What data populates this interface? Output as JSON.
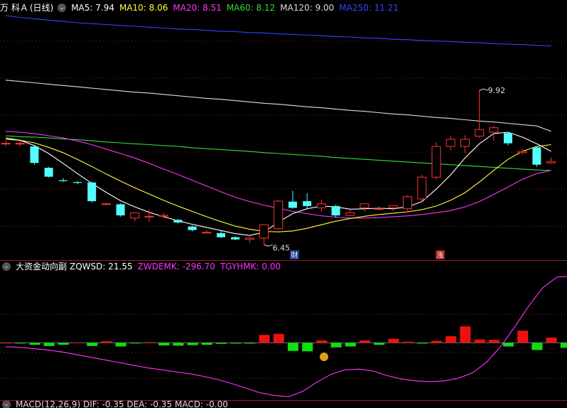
{
  "main_panel": {
    "stock_name": "万 科Ａ",
    "period": "(日线)",
    "ma_items": [
      {
        "label": "MA5: 7.94",
        "color": "#ffffff"
      },
      {
        "label": "MA10: 8.06",
        "color": "#ffff33"
      },
      {
        "label": "MA20: 8.51",
        "color": "#ff33ff"
      },
      {
        "label": "MA60: 8.12",
        "color": "#33dd33"
      },
      {
        "label": "MA120: 9.00",
        "color": "#dddddd"
      },
      {
        "label": "MA250: 11.21",
        "color": "#3344ff"
      }
    ],
    "high_marker": "9.92",
    "low_marker": "6.45",
    "badge_cai": "财",
    "badge_zhang": "涨"
  },
  "sub_panel": {
    "indicator_name": "大资金动向副",
    "items": [
      {
        "label": "ZQWSD: 21.55",
        "color": "#ffffff"
      },
      {
        "label": "ZWDEMK: -296.70",
        "color": "#ff33ff"
      },
      {
        "label": "TGYHMK: 0.00",
        "color": "#ff33ff"
      }
    ]
  },
  "bottom_panel": {
    "partial_legend": "MACD(12,26,9)  DIF: -0.35  DEA: -0.35  MACD: -0.00"
  },
  "colors": {
    "up": "#ff3333",
    "down": "#54ffff",
    "grid": "#9b1c1c",
    "ma5": "#ffffff",
    "ma10": "#ffff33",
    "ma20": "#ff33ff",
    "ma60": "#33dd33",
    "ma120": "#dddddd",
    "ma250": "#3344ff"
  },
  "chart_data": {
    "type": "candlestick",
    "price_range": [
      6.2,
      11.6
    ],
    "candles": [
      {
        "o": 8.73,
        "h": 8.79,
        "l": 8.66,
        "c": 8.73
      },
      {
        "o": 8.73,
        "h": 8.79,
        "l": 8.66,
        "c": 8.73
      },
      {
        "o": 8.66,
        "h": 8.68,
        "l": 8.25,
        "c": 8.29
      },
      {
        "o": 8.18,
        "h": 8.2,
        "l": 7.96,
        "c": 7.98
      },
      {
        "o": 7.9,
        "h": 7.95,
        "l": 7.86,
        "c": 7.88
      },
      {
        "o": 7.86,
        "h": 7.88,
        "l": 7.81,
        "c": 7.84
      },
      {
        "o": 7.85,
        "h": 7.87,
        "l": 7.4,
        "c": 7.43
      },
      {
        "o": 7.36,
        "h": 7.4,
        "l": 7.34,
        "c": 7.37
      },
      {
        "o": 7.36,
        "h": 7.38,
        "l": 7.08,
        "c": 7.11
      },
      {
        "o": 7.05,
        "h": 7.17,
        "l": 6.98,
        "c": 7.17
      },
      {
        "o": 7.09,
        "h": 7.24,
        "l": 6.96,
        "c": 7.09
      },
      {
        "o": 7.09,
        "h": 7.17,
        "l": 7.05,
        "c": 7.11
      },
      {
        "o": 7.01,
        "h": 7.03,
        "l": 6.93,
        "c": 6.95
      },
      {
        "o": 6.86,
        "h": 6.88,
        "l": 6.75,
        "c": 6.78
      },
      {
        "o": 6.73,
        "h": 6.78,
        "l": 6.71,
        "c": 6.73
      },
      {
        "o": 6.71,
        "h": 6.76,
        "l": 6.6,
        "c": 6.62
      },
      {
        "o": 6.62,
        "h": 6.64,
        "l": 6.55,
        "c": 6.57
      },
      {
        "o": 6.57,
        "h": 6.64,
        "l": 6.5,
        "c": 6.6
      },
      {
        "o": 6.6,
        "h": 6.9,
        "l": 6.45,
        "c": 6.9
      },
      {
        "o": 6.81,
        "h": 7.46,
        "l": 6.79,
        "c": 7.43
      },
      {
        "o": 7.42,
        "h": 7.66,
        "l": 7.26,
        "c": 7.28
      },
      {
        "o": 7.43,
        "h": 7.61,
        "l": 7.26,
        "c": 7.32
      },
      {
        "o": 7.28,
        "h": 7.46,
        "l": 7.19,
        "c": 7.37
      },
      {
        "o": 7.32,
        "h": 7.35,
        "l": 7.06,
        "c": 7.11
      },
      {
        "o": 7.11,
        "h": 7.24,
        "l": 7.11,
        "c": 7.17
      },
      {
        "o": 7.28,
        "h": 7.37,
        "l": 7.19,
        "c": 7.37
      },
      {
        "o": 7.26,
        "h": 7.32,
        "l": 7.24,
        "c": 7.26
      },
      {
        "o": 7.28,
        "h": 7.33,
        "l": 7.21,
        "c": 7.33
      },
      {
        "o": 7.26,
        "h": 7.57,
        "l": 7.21,
        "c": 7.53
      },
      {
        "o": 7.48,
        "h": 8.02,
        "l": 7.42,
        "c": 7.97
      },
      {
        "o": 7.97,
        "h": 8.75,
        "l": 7.92,
        "c": 8.66
      },
      {
        "o": 8.66,
        "h": 8.89,
        "l": 8.57,
        "c": 8.82
      },
      {
        "o": 8.66,
        "h": 8.91,
        "l": 8.52,
        "c": 8.82
      },
      {
        "o": 8.89,
        "h": 9.92,
        "l": 8.86,
        "c": 9.04
      },
      {
        "o": 8.98,
        "h": 9.12,
        "l": 8.79,
        "c": 9.08
      },
      {
        "o": 8.96,
        "h": 8.98,
        "l": 8.68,
        "c": 8.73
      },
      {
        "o": 8.52,
        "h": 8.61,
        "l": 8.48,
        "c": 8.55
      },
      {
        "o": 8.64,
        "h": 8.66,
        "l": 8.2,
        "c": 8.25
      },
      {
        "o": 8.29,
        "h": 8.41,
        "l": 8.27,
        "c": 8.32
      }
    ],
    "lines": {
      "ma5": [
        8.85,
        8.8,
        8.68,
        8.5,
        8.28,
        8.05,
        7.83,
        7.63,
        7.44,
        7.3,
        7.18,
        7.08,
        6.99,
        6.91,
        6.84,
        6.77,
        6.7,
        6.66,
        6.73,
        6.96,
        7.15,
        7.26,
        7.32,
        7.3,
        7.25,
        7.26,
        7.27,
        7.26,
        7.3,
        7.42,
        7.7,
        8.02,
        8.4,
        8.72,
        8.95,
        8.98,
        8.87,
        8.72,
        8.55
      ],
      "ma10": [
        8.82,
        8.8,
        8.74,
        8.64,
        8.52,
        8.37,
        8.21,
        8.04,
        7.88,
        7.73,
        7.59,
        7.45,
        7.32,
        7.2,
        7.08,
        6.97,
        6.87,
        6.8,
        6.75,
        6.74,
        6.76,
        6.82,
        6.9,
        6.98,
        7.04,
        7.09,
        7.13,
        7.16,
        7.19,
        7.24,
        7.32,
        7.45,
        7.62,
        7.86,
        8.12,
        8.37,
        8.55,
        8.66,
        8.7
      ],
      "ma20": [
        9.0,
        8.98,
        8.95,
        8.9,
        8.85,
        8.78,
        8.7,
        8.6,
        8.5,
        8.4,
        8.28,
        8.15,
        8.03,
        7.9,
        7.77,
        7.64,
        7.52,
        7.42,
        7.34,
        7.27,
        7.2,
        7.15,
        7.1,
        7.07,
        7.05,
        7.05,
        7.06,
        7.08,
        7.1,
        7.13,
        7.17,
        7.22,
        7.3,
        7.42,
        7.58,
        7.75,
        7.92,
        8.05,
        8.12
      ],
      "ma60": [
        8.9,
        8.88,
        8.87,
        8.85,
        8.83,
        8.81,
        8.79,
        8.76,
        8.74,
        8.72,
        8.7,
        8.68,
        8.66,
        8.63,
        8.61,
        8.59,
        8.57,
        8.55,
        8.52,
        8.5,
        8.48,
        8.46,
        8.44,
        8.41,
        8.39,
        8.37,
        8.35,
        8.33,
        8.31,
        8.29,
        8.27,
        8.25,
        8.23,
        8.21,
        8.19,
        8.17,
        8.15,
        8.13,
        8.12
      ],
      "ma120": [
        10.15,
        10.12,
        10.09,
        10.06,
        10.03,
        10.0,
        9.97,
        9.94,
        9.91,
        9.88,
        9.86,
        9.83,
        9.8,
        9.77,
        9.74,
        9.72,
        9.69,
        9.66,
        9.63,
        9.61,
        9.58,
        9.55,
        9.53,
        9.5,
        9.47,
        9.45,
        9.42,
        9.39,
        9.37,
        9.34,
        9.31,
        9.29,
        9.26,
        9.23,
        9.21,
        9.18,
        9.15,
        9.12,
        9.0
      ],
      "ma250": [
        11.6,
        11.56,
        11.53,
        11.5,
        11.47,
        11.44,
        11.42,
        11.4,
        11.38,
        11.36,
        11.34,
        11.32,
        11.3,
        11.29,
        11.27,
        11.25,
        11.24,
        11.22,
        11.21,
        11.19,
        11.18,
        11.16,
        11.15,
        11.13,
        11.12,
        11.1,
        11.09,
        11.07,
        11.06,
        11.04,
        11.03,
        11.02,
        11.0,
        10.99,
        10.97,
        10.96,
        10.95,
        10.93,
        10.92
      ]
    },
    "sub_range": [
      -420,
      520
    ],
    "sub_bars": [
      0,
      -4,
      -15,
      -25,
      -15,
      2,
      -25,
      12,
      -28,
      -4,
      5,
      -20,
      -22,
      -18,
      -15,
      -8,
      -6,
      -6,
      60,
      68,
      -62,
      -65,
      18,
      -35,
      -28,
      18,
      -15,
      30,
      8,
      -6,
      15,
      50,
      125,
      25,
      22,
      -28,
      92,
      -55,
      40,
      -38,
      -22
    ],
    "sub_line": [
      -30,
      -35,
      -45,
      -55,
      -70,
      -90,
      -110,
      -130,
      -150,
      -170,
      -190,
      -205,
      -220,
      -235,
      -255,
      -280,
      -310,
      -345,
      -380,
      -400,
      -410,
      -370,
      -300,
      -240,
      -205,
      -200,
      -215,
      -250,
      -275,
      -290,
      -295,
      -290,
      -270,
      -230,
      -150,
      -30,
      120,
      280,
      420,
      500,
      505,
      460
    ]
  }
}
